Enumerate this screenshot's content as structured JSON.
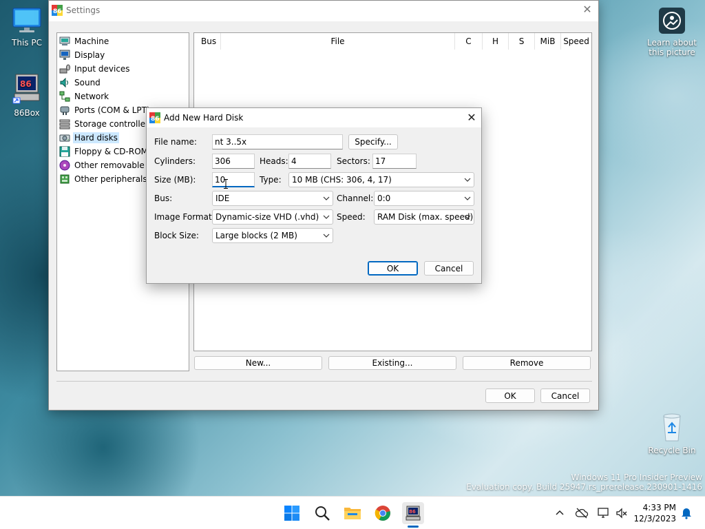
{
  "desktop": {
    "icons": [
      {
        "label": "This PC"
      },
      {
        "label": "86Box"
      },
      {
        "label": "Learn about this picture"
      },
      {
        "label": "Recycle Bin"
      }
    ],
    "watermark_line1": "Windows 11 Pro Insider Preview",
    "watermark_line2": "Evaluation copy. Build 25947.rs_prerelease.230901-1416"
  },
  "settings": {
    "title": "Settings",
    "categories": [
      {
        "label": "Machine",
        "icon": "machine-icon"
      },
      {
        "label": "Display",
        "icon": "display-icon"
      },
      {
        "label": "Input devices",
        "icon": "input-devices-icon"
      },
      {
        "label": "Sound",
        "icon": "sound-icon"
      },
      {
        "label": "Network",
        "icon": "network-icon"
      },
      {
        "label": "Ports (COM & LPT)",
        "icon": "ports-icon"
      },
      {
        "label": "Storage controllers",
        "icon": "storage-controllers-icon"
      },
      {
        "label": "Hard disks",
        "icon": "hard-disk-icon",
        "selected": true
      },
      {
        "label": "Floppy & CD-ROM drives",
        "icon": "floppy-icon"
      },
      {
        "label": "Other removable devices",
        "icon": "removable-devices-icon"
      },
      {
        "label": "Other peripherals",
        "icon": "peripherals-icon"
      }
    ],
    "columns": [
      "Bus",
      "File",
      "C",
      "H",
      "S",
      "MiB",
      "Speed"
    ],
    "buttons": {
      "new": "New...",
      "existing": "Existing...",
      "remove": "Remove",
      "ok": "OK",
      "cancel": "Cancel"
    }
  },
  "dialog": {
    "title": "Add New Hard Disk",
    "file_name_label": "File name:",
    "file_name_value": "nt 3..5x",
    "specify_label": "Specify...",
    "cylinders_label": "Cylinders:",
    "cylinders_value": "306",
    "heads_label": "Heads:",
    "heads_value": "4",
    "sectors_label": "Sectors:",
    "sectors_value": "17",
    "size_label": "Size (MB):",
    "size_value": "10",
    "type_label": "Type:",
    "type_value": "10 MB (CHS: 306, 4, 17)",
    "bus_label": "Bus:",
    "bus_value": "IDE",
    "channel_label": "Channel:",
    "channel_value": "0:0",
    "image_format_label": "Image Format:",
    "image_format_value": "Dynamic-size VHD (.vhd)",
    "speed_label": "Speed:",
    "speed_value": "RAM Disk (max. speed)",
    "block_size_label": "Block Size:",
    "block_size_value": "Large blocks (2 MB)",
    "ok_label": "OK",
    "cancel_label": "Cancel"
  },
  "taskbar": {
    "apps": [
      "start-icon",
      "search-icon",
      "file-explorer-icon",
      "chrome-icon",
      "86box-icon"
    ],
    "time": "4:33 PM",
    "date": "12/3/2023"
  },
  "colors": {
    "accent": "#0067c0",
    "selection": "#cce8ff"
  }
}
